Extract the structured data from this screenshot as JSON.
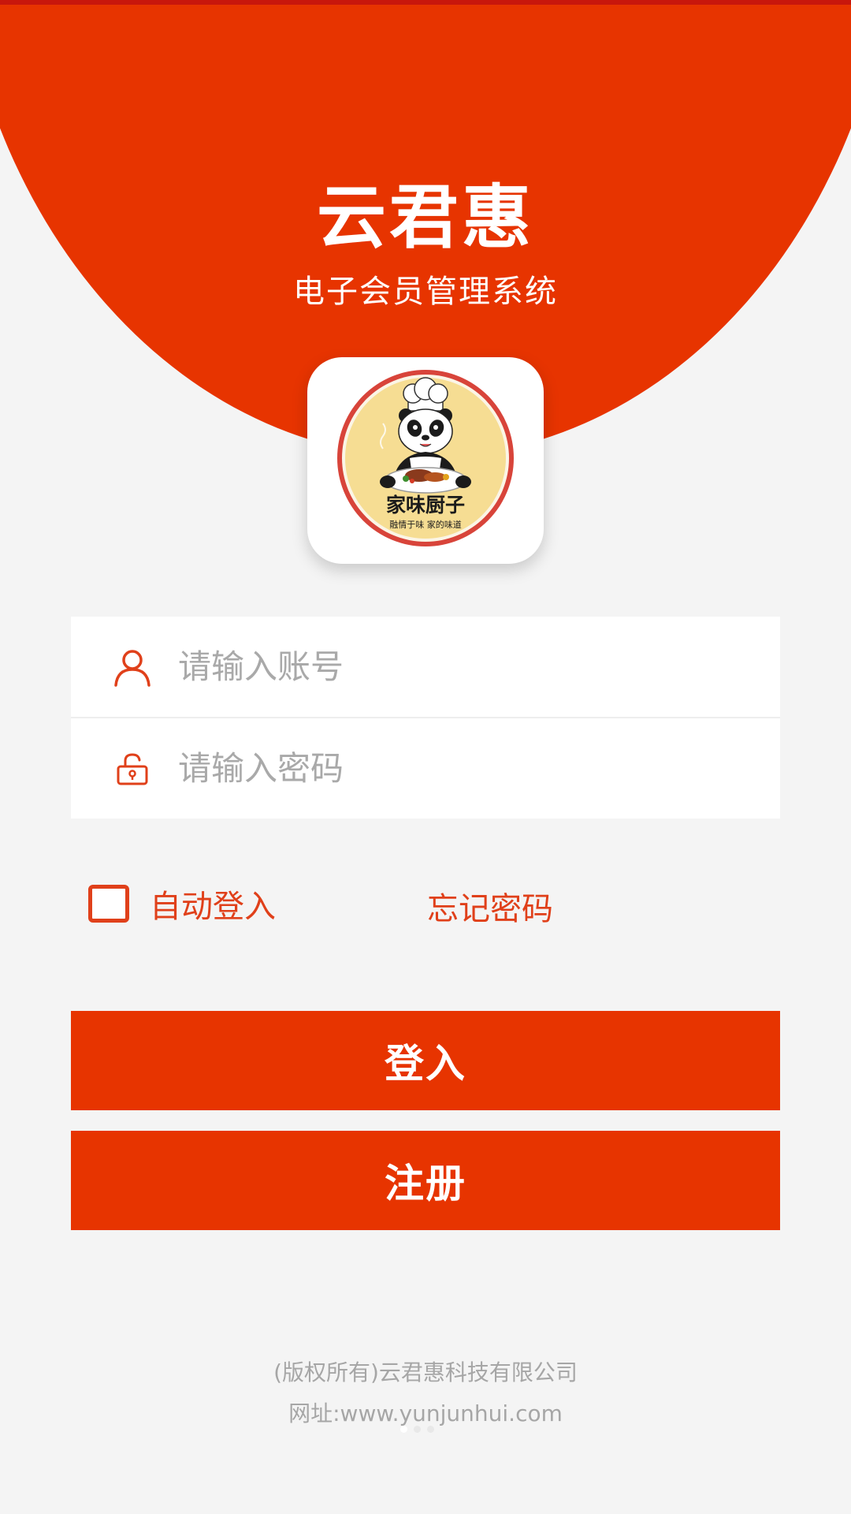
{
  "header": {
    "title": "云君惠",
    "subtitle": "电子会员管理系统",
    "accent_color": "#e73400"
  },
  "logo": {
    "name": "家味厨子",
    "slogan": "融情于味 家的味道",
    "icon": "panda-chef-logo"
  },
  "form": {
    "account": {
      "placeholder": "请输入账号",
      "value": "",
      "icon": "user-icon"
    },
    "password": {
      "placeholder": "请输入密码",
      "value": "",
      "icon": "lock-icon"
    }
  },
  "options": {
    "auto_login_label": "自动登入",
    "auto_login_checked": false,
    "forgot_password_label": "忘记密码"
  },
  "buttons": {
    "login_label": "登入",
    "register_label": "注册"
  },
  "footer": {
    "copyright": "(版权所有)云君惠科技有限公司",
    "website": "网址:www.yunjunhui.com"
  }
}
